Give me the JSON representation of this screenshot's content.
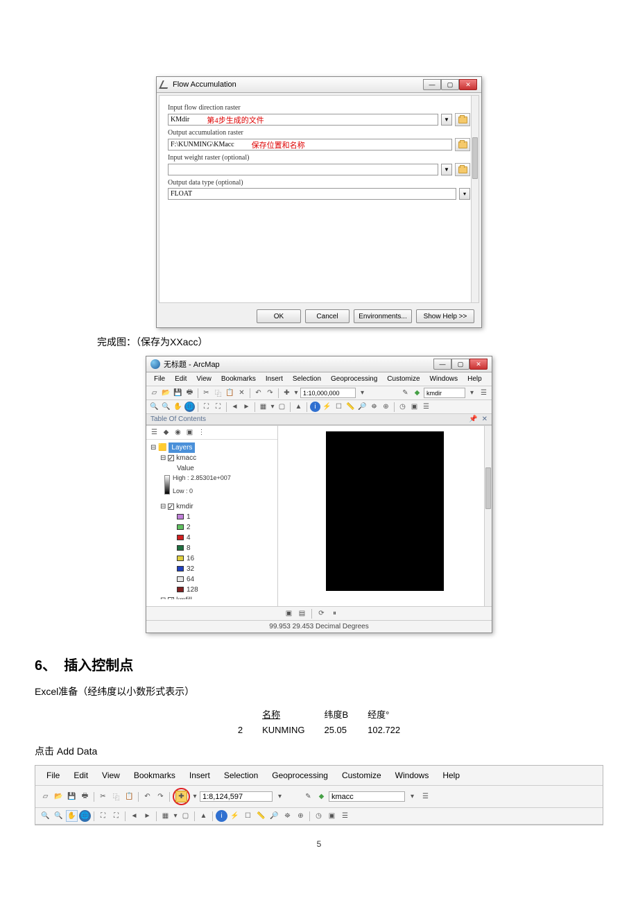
{
  "dialog": {
    "title": "Flow Accumulation",
    "label1": "Input flow direction raster",
    "input1": "KMdir",
    "note1": "第4步生成的文件",
    "label2": "Output accumulation raster",
    "input2": "F:\\KUNMING\\KMacc",
    "note2": "保存位置和名称",
    "label3": "Input weight raster (optional)",
    "label4": "Output data type (optional)",
    "input4": "FLOAT",
    "btn_ok": "OK",
    "btn_cancel": "Cancel",
    "btn_env": "Environments...",
    "btn_help": "Show Help >>"
  },
  "text1": "完成图：（保存为XXacc）",
  "arcmap": {
    "title": "无标题 - ArcMap",
    "menus": [
      "File",
      "Edit",
      "View",
      "Bookmarks",
      "Insert",
      "Selection",
      "Geoprocessing",
      "Customize",
      "Windows",
      "Help"
    ],
    "scale": "1:10,000,000",
    "layer_combo": "kmdir",
    "toc_title": "Table Of Contents",
    "root": "Layers",
    "kmacc": "kmacc",
    "value_label": "Value",
    "high": "High : 2.85301e+007",
    "low": "Low : 0",
    "kmdir": "kmdir",
    "dir_vals": [
      "1",
      "2",
      "4",
      "8",
      "16",
      "32",
      "64",
      "128"
    ],
    "dir_colors": [
      "#c080d8",
      "#60c060",
      "#d02020",
      "#207040",
      "#e0d040",
      "#2040c0",
      "#e8e8e8",
      "#802020"
    ],
    "kmfill": "kmfill",
    "status": "99.953  29.453 Decimal Degrees"
  },
  "section6_num": "6、",
  "section6_title": "插入控制点",
  "excel_note": "Excel准备（经纬度以小数形式表示）",
  "table": {
    "h_name": "名称",
    "h_lat": "纬度B",
    "h_lon": "经度°",
    "row_num": "2",
    "name": "KUNMING",
    "lat": "25.05",
    "lon": "102.722"
  },
  "add_data": "点击 Add Data",
  "toolbar2": {
    "menus": [
      "File",
      "Edit",
      "View",
      "Bookmarks",
      "Insert",
      "Selection",
      "Geoprocessing",
      "Customize",
      "Windows",
      "Help"
    ],
    "scale": "1:8,124,597",
    "layer_combo": "kmacc"
  },
  "page_num": "5"
}
